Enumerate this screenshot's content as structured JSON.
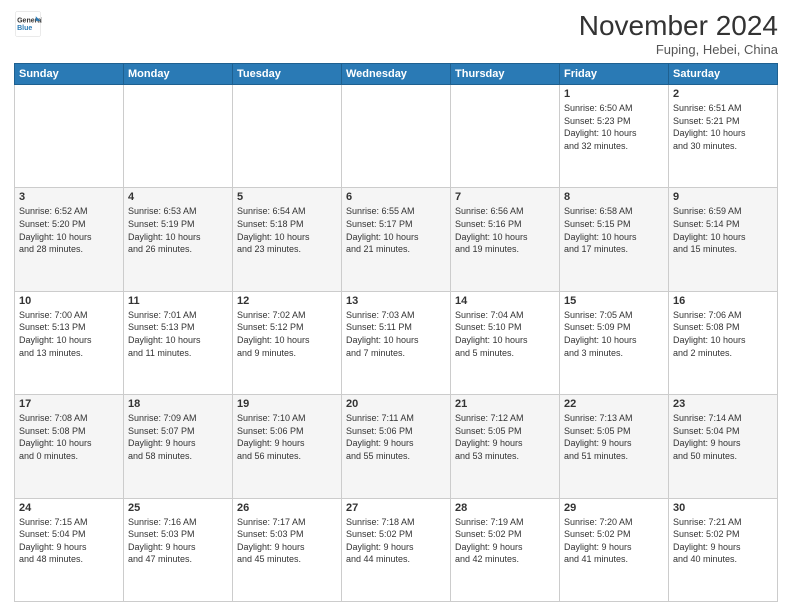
{
  "logo": {
    "line1": "General",
    "line2": "Blue"
  },
  "title": "November 2024",
  "location": "Fuping, Hebei, China",
  "days_of_week": [
    "Sunday",
    "Monday",
    "Tuesday",
    "Wednesday",
    "Thursday",
    "Friday",
    "Saturday"
  ],
  "weeks": [
    [
      {
        "day": "",
        "info": ""
      },
      {
        "day": "",
        "info": ""
      },
      {
        "day": "",
        "info": ""
      },
      {
        "day": "",
        "info": ""
      },
      {
        "day": "",
        "info": ""
      },
      {
        "day": "1",
        "info": "Sunrise: 6:50 AM\nSunset: 5:23 PM\nDaylight: 10 hours\nand 32 minutes."
      },
      {
        "day": "2",
        "info": "Sunrise: 6:51 AM\nSunset: 5:21 PM\nDaylight: 10 hours\nand 30 minutes."
      }
    ],
    [
      {
        "day": "3",
        "info": "Sunrise: 6:52 AM\nSunset: 5:20 PM\nDaylight: 10 hours\nand 28 minutes."
      },
      {
        "day": "4",
        "info": "Sunrise: 6:53 AM\nSunset: 5:19 PM\nDaylight: 10 hours\nand 26 minutes."
      },
      {
        "day": "5",
        "info": "Sunrise: 6:54 AM\nSunset: 5:18 PM\nDaylight: 10 hours\nand 23 minutes."
      },
      {
        "day": "6",
        "info": "Sunrise: 6:55 AM\nSunset: 5:17 PM\nDaylight: 10 hours\nand 21 minutes."
      },
      {
        "day": "7",
        "info": "Sunrise: 6:56 AM\nSunset: 5:16 PM\nDaylight: 10 hours\nand 19 minutes."
      },
      {
        "day": "8",
        "info": "Sunrise: 6:58 AM\nSunset: 5:15 PM\nDaylight: 10 hours\nand 17 minutes."
      },
      {
        "day": "9",
        "info": "Sunrise: 6:59 AM\nSunset: 5:14 PM\nDaylight: 10 hours\nand 15 minutes."
      }
    ],
    [
      {
        "day": "10",
        "info": "Sunrise: 7:00 AM\nSunset: 5:13 PM\nDaylight: 10 hours\nand 13 minutes."
      },
      {
        "day": "11",
        "info": "Sunrise: 7:01 AM\nSunset: 5:13 PM\nDaylight: 10 hours\nand 11 minutes."
      },
      {
        "day": "12",
        "info": "Sunrise: 7:02 AM\nSunset: 5:12 PM\nDaylight: 10 hours\nand 9 minutes."
      },
      {
        "day": "13",
        "info": "Sunrise: 7:03 AM\nSunset: 5:11 PM\nDaylight: 10 hours\nand 7 minutes."
      },
      {
        "day": "14",
        "info": "Sunrise: 7:04 AM\nSunset: 5:10 PM\nDaylight: 10 hours\nand 5 minutes."
      },
      {
        "day": "15",
        "info": "Sunrise: 7:05 AM\nSunset: 5:09 PM\nDaylight: 10 hours\nand 3 minutes."
      },
      {
        "day": "16",
        "info": "Sunrise: 7:06 AM\nSunset: 5:08 PM\nDaylight: 10 hours\nand 2 minutes."
      }
    ],
    [
      {
        "day": "17",
        "info": "Sunrise: 7:08 AM\nSunset: 5:08 PM\nDaylight: 10 hours\nand 0 minutes."
      },
      {
        "day": "18",
        "info": "Sunrise: 7:09 AM\nSunset: 5:07 PM\nDaylight: 9 hours\nand 58 minutes."
      },
      {
        "day": "19",
        "info": "Sunrise: 7:10 AM\nSunset: 5:06 PM\nDaylight: 9 hours\nand 56 minutes."
      },
      {
        "day": "20",
        "info": "Sunrise: 7:11 AM\nSunset: 5:06 PM\nDaylight: 9 hours\nand 55 minutes."
      },
      {
        "day": "21",
        "info": "Sunrise: 7:12 AM\nSunset: 5:05 PM\nDaylight: 9 hours\nand 53 minutes."
      },
      {
        "day": "22",
        "info": "Sunrise: 7:13 AM\nSunset: 5:05 PM\nDaylight: 9 hours\nand 51 minutes."
      },
      {
        "day": "23",
        "info": "Sunrise: 7:14 AM\nSunset: 5:04 PM\nDaylight: 9 hours\nand 50 minutes."
      }
    ],
    [
      {
        "day": "24",
        "info": "Sunrise: 7:15 AM\nSunset: 5:04 PM\nDaylight: 9 hours\nand 48 minutes."
      },
      {
        "day": "25",
        "info": "Sunrise: 7:16 AM\nSunset: 5:03 PM\nDaylight: 9 hours\nand 47 minutes."
      },
      {
        "day": "26",
        "info": "Sunrise: 7:17 AM\nSunset: 5:03 PM\nDaylight: 9 hours\nand 45 minutes."
      },
      {
        "day": "27",
        "info": "Sunrise: 7:18 AM\nSunset: 5:02 PM\nDaylight: 9 hours\nand 44 minutes."
      },
      {
        "day": "28",
        "info": "Sunrise: 7:19 AM\nSunset: 5:02 PM\nDaylight: 9 hours\nand 42 minutes."
      },
      {
        "day": "29",
        "info": "Sunrise: 7:20 AM\nSunset: 5:02 PM\nDaylight: 9 hours\nand 41 minutes."
      },
      {
        "day": "30",
        "info": "Sunrise: 7:21 AM\nSunset: 5:02 PM\nDaylight: 9 hours\nand 40 minutes."
      }
    ]
  ]
}
